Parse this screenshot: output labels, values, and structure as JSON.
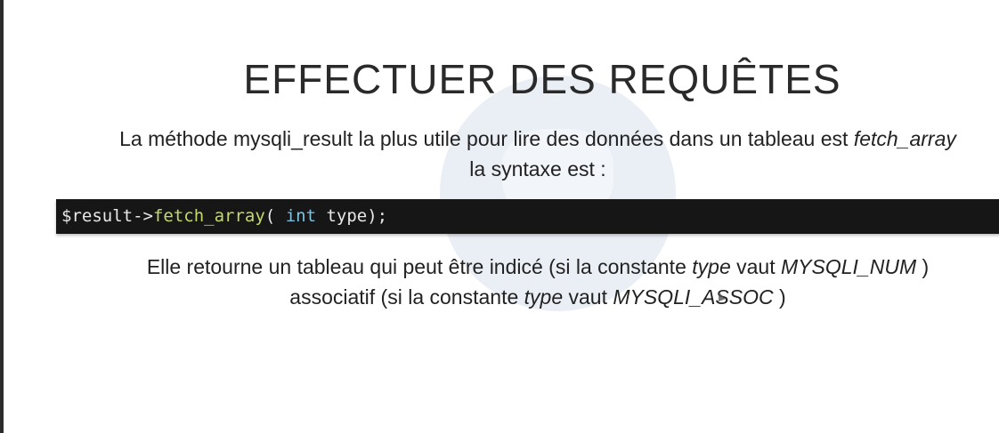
{
  "slide": {
    "title": "EFFECTUER DES REQUÊTES",
    "intro": {
      "line1_text": "La méthode mysqli_result la plus utile pour lire des données dans un tableau est ",
      "line1_em": "fetch_array",
      "line2": "la syntaxe est :"
    },
    "code": {
      "var": "$result->",
      "fn": "fetch_array",
      "open": "( ",
      "kw": "int",
      "rest": " type);"
    },
    "desc": {
      "l1_a": "Elle retourne un tableau qui peut être indicé (si la constante ",
      "l1_em1": "type",
      "l1_b": " vaut ",
      "l1_em2": "MYSQLI_NUM",
      "l1_c": " )",
      "l2_a": "associatif (si la constante ",
      "l2_em1": "type",
      "l2_b": " vaut ",
      "l2_em2": "MYSQLI_ASSOC",
      "l2_c": " )"
    },
    "colors": {
      "background": "#ffffff",
      "code_background": "#161616",
      "code_function": "#c2d96a",
      "code_keyword": "#7fc3e0"
    }
  }
}
